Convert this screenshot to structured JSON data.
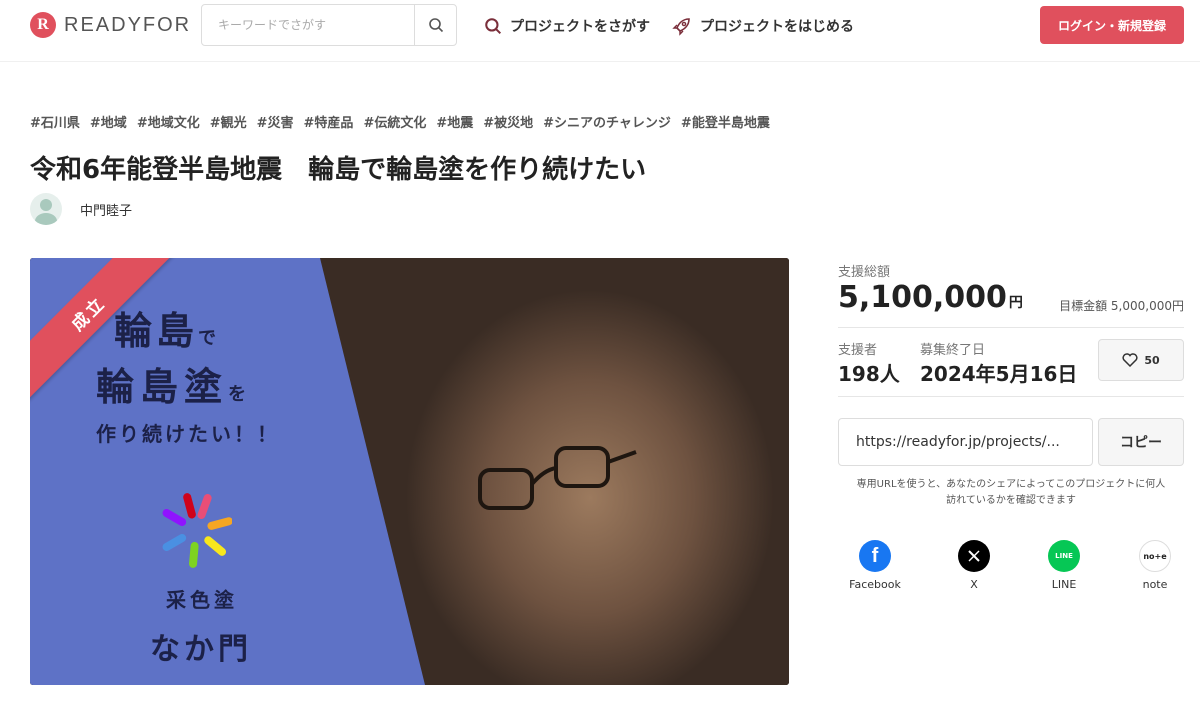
{
  "header": {
    "logo_mark": "R",
    "logo_text": "READYFOR",
    "search_placeholder": "キーワードでさがす",
    "nav_find": "プロジェクトをさがす",
    "nav_start": "プロジェクトをはじめる",
    "login": "ログイン・新規登録"
  },
  "project": {
    "tags": [
      "#石川県",
      "#地域",
      "#地域文化",
      "#観光",
      "#災害",
      "#特産品",
      "#伝統文化",
      "#地震",
      "#被災地",
      "#シニアのチャレンジ",
      "#能登半島地震"
    ],
    "title": "令和6年能登半島地震　輪島で輪島塗を作り続けたい",
    "owner": "中門睦子"
  },
  "hero": {
    "ribbon": "成立",
    "line1_main": "輪島",
    "line1_small": "で",
    "line2_main": "輪島塗",
    "line2_small": "を",
    "line3": "作り続けたい！！",
    "brand1": "采色塗",
    "brand2": "なか門"
  },
  "stats": {
    "total_label": "支援総額",
    "total_value": "5,100,000",
    "total_unit": "円",
    "goal": "目標金額 5,000,000円",
    "supporters_label": "支援者",
    "supporters_value": "198人",
    "end_label": "募集終了日",
    "end_value": "2024年5月16日",
    "favorites": "50"
  },
  "share": {
    "url": "https://readyfor.jp/projects/...",
    "copy": "コピー",
    "note": "専用URLを使うと、あなたのシェアによってこのプロジェクトに何人訪れているかを確認できます",
    "facebook": "Facebook",
    "x": "X",
    "line": "LINE",
    "note_service": "note",
    "line_icon_text": "LINE",
    "note_icon_text": "no+e"
  },
  "colors": {
    "accent": "#e0505d",
    "hero_blue": "#5e72c6",
    "facebook": "#1877f2",
    "line": "#06c755"
  }
}
